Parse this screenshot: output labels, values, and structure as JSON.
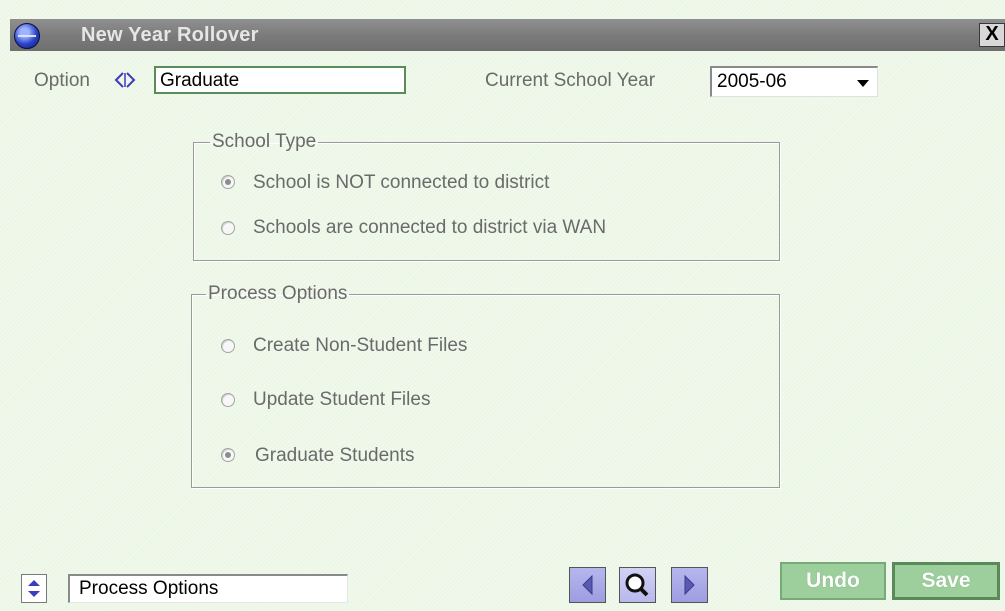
{
  "window": {
    "title": "New Year Rollover",
    "close_label": "X"
  },
  "header": {
    "option_label": "Option",
    "option_value": "Graduate",
    "school_year_label": "Current School Year",
    "school_year_value": "2005-06"
  },
  "school_type": {
    "legend": "School Type",
    "options": [
      {
        "label": "School is NOT connected to district",
        "checked": true
      },
      {
        "label": "Schools are connected to district via WAN",
        "checked": false
      }
    ]
  },
  "process_options": {
    "legend": "Process Options",
    "options": [
      {
        "label": "Create Non-Student Files",
        "checked": false
      },
      {
        "label": "Update Student Files",
        "checked": false
      },
      {
        "label": "Graduate Students",
        "checked": true
      }
    ]
  },
  "footer": {
    "section_value": "Process Options",
    "undo_label": "Undo",
    "save_label": "Save"
  },
  "colors": {
    "background": "#ecf6e6",
    "titlebar": "#7a7a7a",
    "action_button": "#9ccf9c",
    "nav_button": "#a9a9e8"
  },
  "icons": [
    "app-icon",
    "close-icon",
    "option-nav-arrows-icon",
    "spinner-icon",
    "prev-icon",
    "find-icon",
    "next-icon"
  ]
}
